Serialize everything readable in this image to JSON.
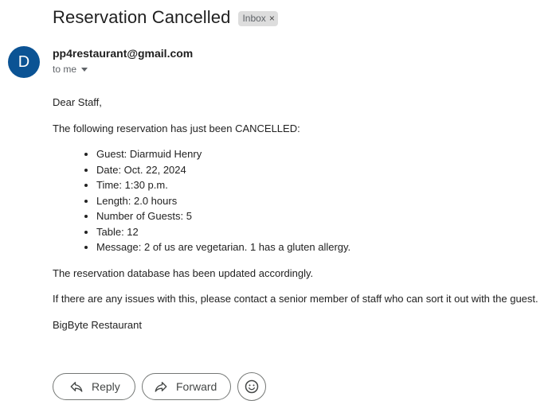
{
  "email": {
    "subject": "Reservation Cancelled",
    "label": "Inbox",
    "label_close_icon": "close-icon",
    "avatar_letter": "D",
    "avatar_color": "#0b5394",
    "sender": "pp4restaurant@gmail.com",
    "recipient_line": "to me",
    "greeting": "Dear Staff,",
    "intro": "The following reservation has just been CANCELLED:",
    "details": [
      "Guest: Diarmuid Henry",
      "Date: Oct. 22, 2024",
      "Time: 1:30 p.m.",
      "Length: 2.0 hours",
      "Number of Guests: 5",
      "Table: 12",
      "Message: 2 of us are vegetarian. 1 has a gluten allergy."
    ],
    "update_note": "The reservation database has been updated accordingly.",
    "issues_note": "If there are any issues with this, please contact a senior member of staff who can sort it out with the guest.",
    "signature": "BigByte Restaurant"
  },
  "actions": {
    "reply_label": "Reply",
    "reply_icon": "reply-icon",
    "forward_label": "Forward",
    "forward_icon": "forward-icon",
    "emoji_icon": "emoji-icon"
  }
}
